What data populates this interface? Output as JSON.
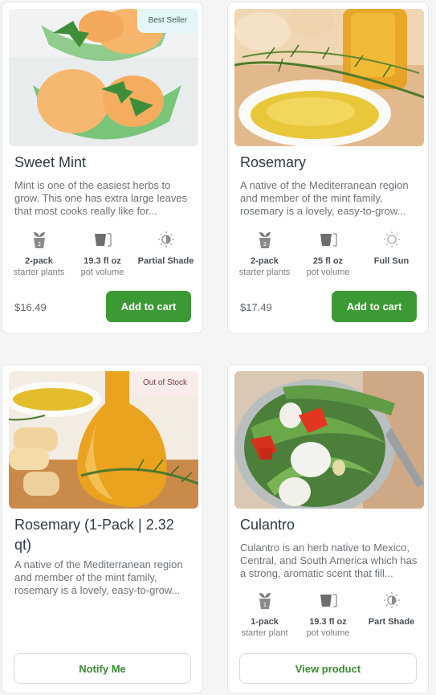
{
  "products": [
    {
      "badge": "Best Seller",
      "title": "Sweet Mint",
      "description": "Mint is one of the easiest herbs to grow. This one has extra large leaves that most cooks really like for...",
      "specs": [
        {
          "icon": "pot-plant-icon",
          "count": "2",
          "value": "2-pack",
          "unit": "starter plants"
        },
        {
          "icon": "pot-volume-icon",
          "value": "19.3 fl oz",
          "unit": "pot volume"
        },
        {
          "icon": "partial-shade-icon",
          "value": "Partial Shade",
          "unit": ""
        }
      ],
      "price": "$16.49",
      "button": "Add to cart"
    },
    {
      "badge": "",
      "title": "Rosemary",
      "description": "A native of the Mediterranean region and member of the mint family, rosemary is a lovely, easy-to-grow...",
      "specs": [
        {
          "icon": "pot-plant-icon",
          "count": "2",
          "value": "2-pack",
          "unit": "starter plants"
        },
        {
          "icon": "pot-volume-icon",
          "value": "25 fl oz",
          "unit": "pot volume"
        },
        {
          "icon": "full-sun-icon",
          "value": "Full Sun",
          "unit": ""
        }
      ],
      "price": "$17.49",
      "button": "Add to cart"
    },
    {
      "badge": "Out of Stock",
      "title": "Rosemary (1-Pack | 2.32 qt)",
      "description": "A native of the Mediterranean region and member of the mint family, rosemary is a lovely, easy-to-grow...",
      "button": "Notify Me"
    },
    {
      "badge": "",
      "title": "Culantro",
      "description": "Culantro is an herb native to Mexico, Central, and South America which has a strong, aromatic scent that fill...",
      "specs": [
        {
          "icon": "pot-plant-icon",
          "count": "1",
          "value": "1-pack",
          "unit": "starter plant"
        },
        {
          "icon": "pot-volume-icon",
          "value": "19.3 fl oz",
          "unit": "pot volume"
        },
        {
          "icon": "part-shade-icon",
          "value": "Part Shade",
          "unit": ""
        }
      ],
      "button": "View product"
    }
  ],
  "colors": {
    "accent": "#3c9a35",
    "best_seller_bg": "#e4f6f7",
    "out_of_stock_bg": "#fbecec"
  }
}
